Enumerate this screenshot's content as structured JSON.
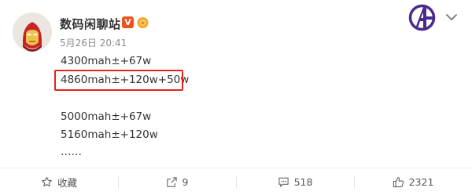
{
  "user": {
    "name": "数码闲聊站",
    "verified_badge": "V",
    "timestamp": "5月26日 20:41"
  },
  "content": {
    "lines": [
      "4300mah±+67w",
      "4860mah±+120w+50w",
      "5000mah±+67w",
      "5160mah±+120w",
      "……"
    ]
  },
  "icons": {
    "avatar": "iron-man-avatar",
    "brand": "avengers-logo-icon",
    "expand": "chevron-down-icon",
    "favorite": "star-icon",
    "repost": "share-arrow-icon",
    "comment": "comment-bubble-icon",
    "like": "thumbs-up-icon"
  },
  "actions": {
    "favorite_label": "收藏",
    "repost_count": "9",
    "comment_count": "518",
    "like_count": "2321"
  },
  "colors": {
    "highlight_border": "#e0241f",
    "verified_badge": "#f0511c",
    "brand_purple": "#4a2a8c"
  }
}
